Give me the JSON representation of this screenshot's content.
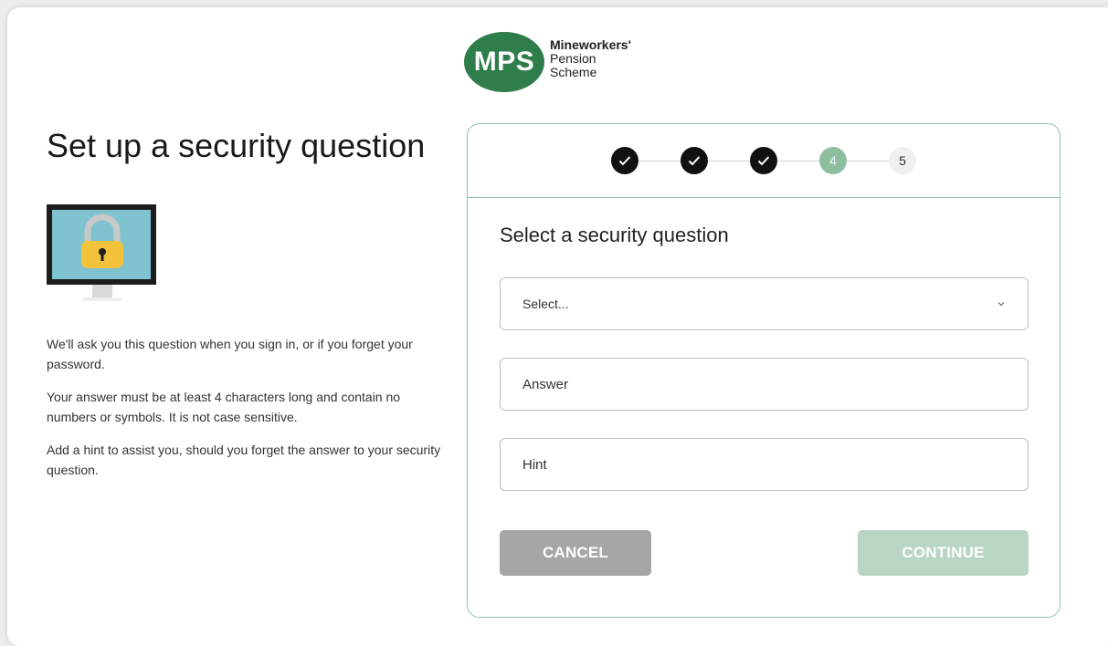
{
  "logo": {
    "initials": "MPS",
    "line1": "Mineworkers'",
    "line2": "Pension",
    "line3": "Scheme"
  },
  "left": {
    "heading": "Set up a security question",
    "paragraphs": [
      "We'll ask you this question when you sign in, or if you forget your password.",
      "Your answer must be at least 4 characters long and contain no numbers or symbols. It is not case sensitive.",
      "Add a hint to assist you, should you forget the answer to your security question."
    ]
  },
  "stepper": {
    "steps": [
      {
        "state": "done",
        "icon": "check-icon"
      },
      {
        "state": "done",
        "icon": "check-icon"
      },
      {
        "state": "done",
        "icon": "check-icon"
      },
      {
        "state": "current",
        "label": "4"
      },
      {
        "state": "todo",
        "label": "5"
      }
    ]
  },
  "form": {
    "title": "Select a security question",
    "select_value": "Select...",
    "answer_placeholder": "Answer",
    "hint_placeholder": "Hint",
    "cancel_label": "CANCEL",
    "continue_label": "CONTINUE"
  },
  "colors": {
    "brand_green": "#2f7d4b",
    "card_border": "#8cc4a7",
    "current_step": "#8dbf9e",
    "continue_disabled": "#b9d6c4",
    "cancel_grey": "#a6a6a6"
  }
}
